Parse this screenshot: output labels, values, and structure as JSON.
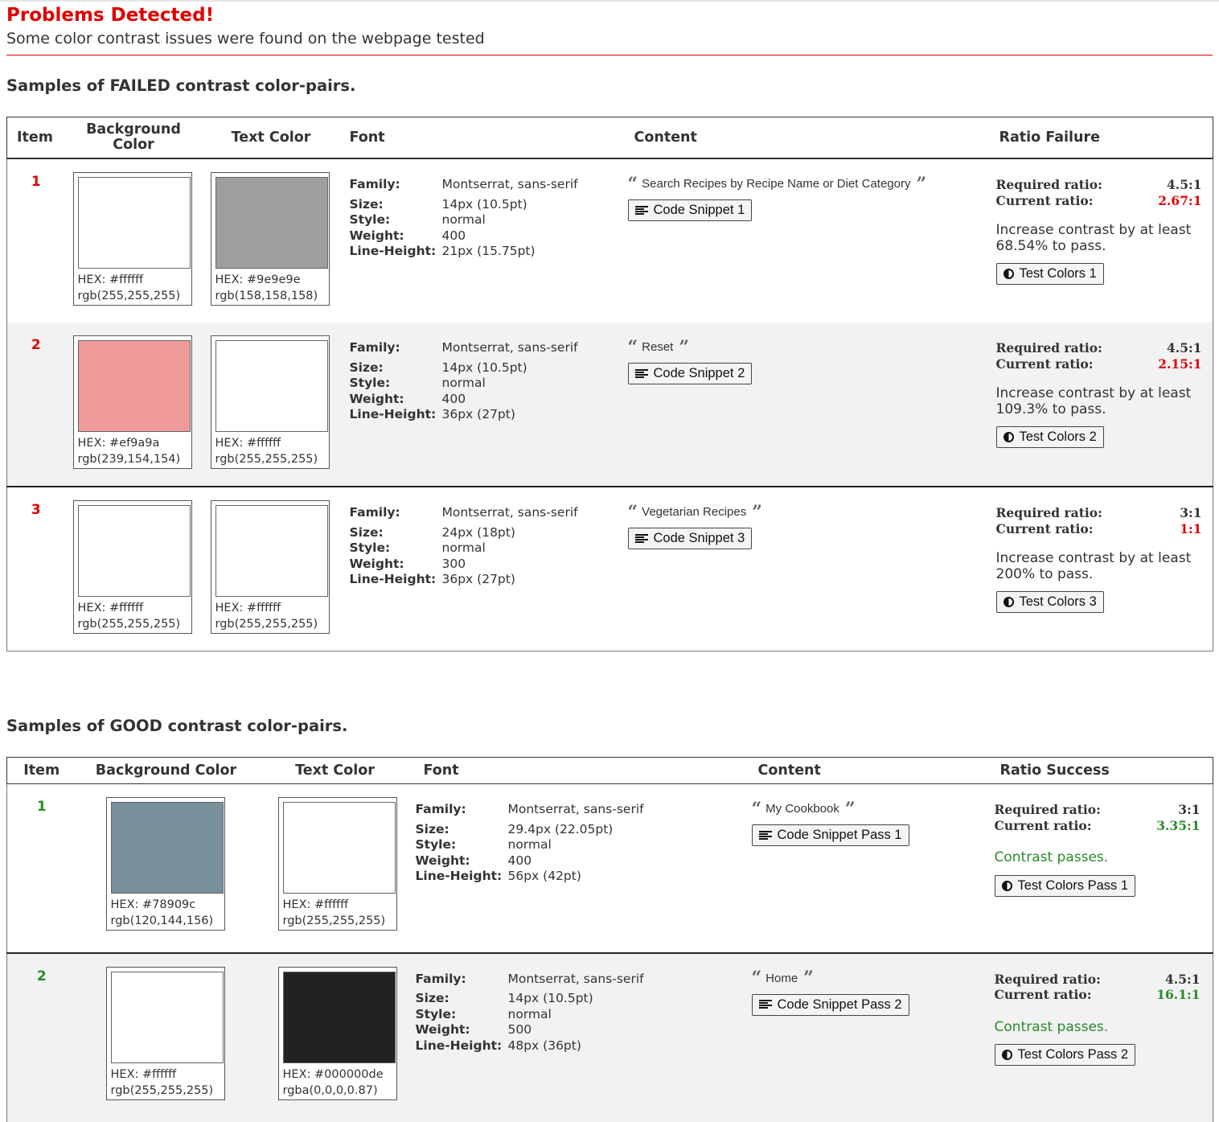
{
  "header": {
    "title": "Problems Detected!",
    "subtitle": "Some color contrast issues were found on the webpage tested"
  },
  "failed_section": {
    "heading": "Samples of FAILED contrast color-pairs.",
    "columns": [
      "Item",
      "Background Color",
      "Text Color",
      "Font",
      "Content",
      "Ratio Failure"
    ],
    "rows": [
      {
        "item": "1",
        "bg": {
          "color": "#ffffff",
          "hex": "HEX: #ffffff",
          "rgb": "rgb(255,255,255)"
        },
        "fg": {
          "color": "#9e9e9e",
          "hex": "HEX: #9e9e9e",
          "rgb": "rgb(158,158,158)"
        },
        "font": {
          "family": "Montserrat, sans-serif",
          "size": "14px (10.5pt)",
          "style": "normal",
          "weight": "400",
          "line_height": "21px (15.75pt)"
        },
        "content": "Search Recipes by Recipe Name or Diet Category",
        "snippet_label": "Code Snippet 1",
        "required": "4.5:1",
        "current": "2.67:1",
        "message": "Increase contrast by at least 68.54% to pass.",
        "test_label": "Test Colors 1"
      },
      {
        "item": "2",
        "bg": {
          "color": "#ef9a9a",
          "hex": "HEX: #ef9a9a",
          "rgb": "rgb(239,154,154)"
        },
        "fg": {
          "color": "#ffffff",
          "hex": "HEX: #ffffff",
          "rgb": "rgb(255,255,255)"
        },
        "font": {
          "family": "Montserrat, sans-serif",
          "size": "14px (10.5pt)",
          "style": "normal",
          "weight": "400",
          "line_height": "36px (27pt)"
        },
        "content": "Reset",
        "snippet_label": "Code Snippet 2",
        "required": "4.5:1",
        "current": "2.15:1",
        "message": "Increase contrast by at least 109.3% to pass.",
        "test_label": "Test Colors 2"
      },
      {
        "item": "3",
        "bg": {
          "color": "#ffffff",
          "hex": "HEX: #ffffff",
          "rgb": "rgb(255,255,255)"
        },
        "fg": {
          "color": "#ffffff",
          "hex": "HEX: #ffffff",
          "rgb": "rgb(255,255,255)"
        },
        "font": {
          "family": "Montserrat, sans-serif",
          "size": "24px (18pt)",
          "style": "normal",
          "weight": "300",
          "line_height": "36px (27pt)"
        },
        "content": "Vegetarian Recipes",
        "snippet_label": "Code Snippet 3",
        "required": "3:1",
        "current": "1:1",
        "message": "Increase contrast by at least 200% to pass.",
        "test_label": "Test Colors 3"
      }
    ]
  },
  "good_section": {
    "heading": "Samples of GOOD contrast color-pairs.",
    "columns": [
      "Item",
      "Background Color",
      "Text Color",
      "Font",
      "Content",
      "Ratio Success"
    ],
    "rows": [
      {
        "item": "1",
        "bg": {
          "color": "#78909c",
          "hex": "HEX: #78909c",
          "rgb": "rgb(120,144,156)"
        },
        "fg": {
          "color": "#ffffff",
          "hex": "HEX: #ffffff",
          "rgb": "rgb(255,255,255)"
        },
        "font": {
          "family": "Montserrat, sans-serif",
          "size": "29.4px (22.05pt)",
          "style": "normal",
          "weight": "400",
          "line_height": "56px (42pt)"
        },
        "content": "My Cookbook",
        "snippet_label": "Code Snippet Pass 1",
        "required": "3:1",
        "current": "3.35:1",
        "message": "Contrast passes.",
        "test_label": "Test Colors Pass 1"
      },
      {
        "item": "2",
        "bg": {
          "color": "#ffffff",
          "hex": "HEX: #ffffff",
          "rgb": "rgb(255,255,255)"
        },
        "fg": {
          "color": "#222222",
          "hex": "HEX: #000000de",
          "rgb": "rgba(0,0,0,0.87)"
        },
        "font": {
          "family": "Montserrat, sans-serif",
          "size": "14px (10.5pt)",
          "style": "normal",
          "weight": "500",
          "line_height": "48px (36pt)"
        },
        "content": "Home",
        "snippet_label": "Code Snippet Pass 2",
        "required": "4.5:1",
        "current": "16.1:1",
        "message": "Contrast passes.",
        "test_label": "Test Colors Pass 2"
      }
    ]
  },
  "labels": {
    "family": "Family:",
    "size": "Size:",
    "style": "Style:",
    "weight": "Weight:",
    "line_height": "Line-Height:",
    "required_ratio": "Required ratio:",
    "current_ratio": "Current ratio:"
  },
  "icons": {
    "quote_open": "quote-left-icon",
    "quote_close": "quote-right-icon",
    "snippet": "align-left-icon",
    "test": "adjust-contrast-icon"
  },
  "colors": {
    "error": "#e00000",
    "success": "#2a8a2a",
    "alt_row": "#f2f2f2"
  }
}
